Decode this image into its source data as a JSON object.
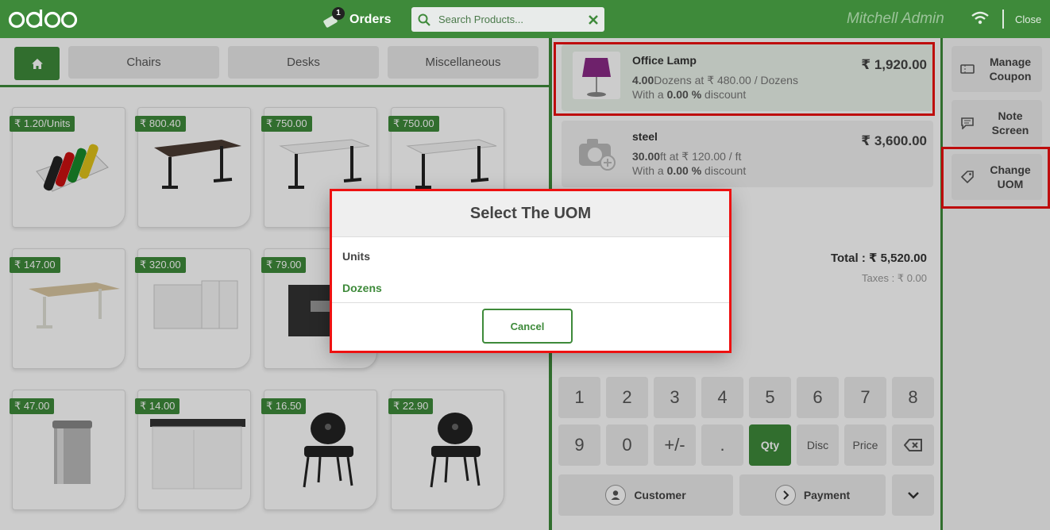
{
  "header": {
    "logo_text": "odoo",
    "orders_label": "Orders",
    "orders_count": "1",
    "search_placeholder": "Search Products...",
    "user_name": "Mitchell Admin",
    "close_label": "Close"
  },
  "categories": {
    "home_icon": "home-icon",
    "items": [
      "Chairs",
      "Desks",
      "Miscellaneous"
    ]
  },
  "products": [
    {
      "price": "₹ 1.20/Units",
      "icon": "markers"
    },
    {
      "price": "₹ 800.40",
      "icon": "desk-dark"
    },
    {
      "price": "₹ 750.00",
      "icon": "desk-white"
    },
    {
      "price": "₹ 750.00",
      "icon": "desk-white"
    },
    {
      "price": "₹ 147.00",
      "icon": "desk-wood"
    },
    {
      "price": "₹ 320.00",
      "icon": "cabinet"
    },
    {
      "price": "₹ 79.00",
      "icon": "box"
    },
    {
      "price": "₹ 47.00",
      "icon": "bin"
    },
    {
      "price": "₹ 14.00",
      "icon": "cabinet-low"
    },
    {
      "price": "₹ 16.50",
      "icon": "chair"
    },
    {
      "price": "₹ 22.90",
      "icon": "chair"
    }
  ],
  "order": {
    "lines": [
      {
        "name": "Office Lamp",
        "qty": "4.00",
        "unit": "Dozens",
        "unit_price": "₹ 480.00",
        "discount": "0.00 %",
        "total": "₹ 1,920.00"
      },
      {
        "name": "steel",
        "qty": "30.00",
        "unit": "ft",
        "unit_price": "₹ 120.00",
        "discount": "0.00 %",
        "total": "₹ 3,600.00"
      }
    ],
    "total_label": "Total : ₹ 5,520.00",
    "taxes_label": "Taxes : ₹ 0.00"
  },
  "numpad": {
    "row1": [
      "1",
      "2",
      "3",
      "4",
      "5",
      "6",
      "7",
      "8"
    ],
    "row2": [
      "9",
      "0",
      "+/-",
      ".",
      "Qty",
      "Disc",
      "Price"
    ],
    "customer_label": "Customer",
    "payment_label": "Payment"
  },
  "actions": [
    {
      "label1": "Manage",
      "label2": "Coupon"
    },
    {
      "label1": "Note",
      "label2": "Screen"
    },
    {
      "label1": "Change",
      "label2": "UOM"
    }
  ],
  "dialog": {
    "title": "Select The UOM",
    "options": [
      "Units",
      "Dozens"
    ],
    "cancel_label": "Cancel"
  },
  "colors": {
    "brand_green": "#3e8a3a",
    "highlight_red": "#ee1111"
  }
}
